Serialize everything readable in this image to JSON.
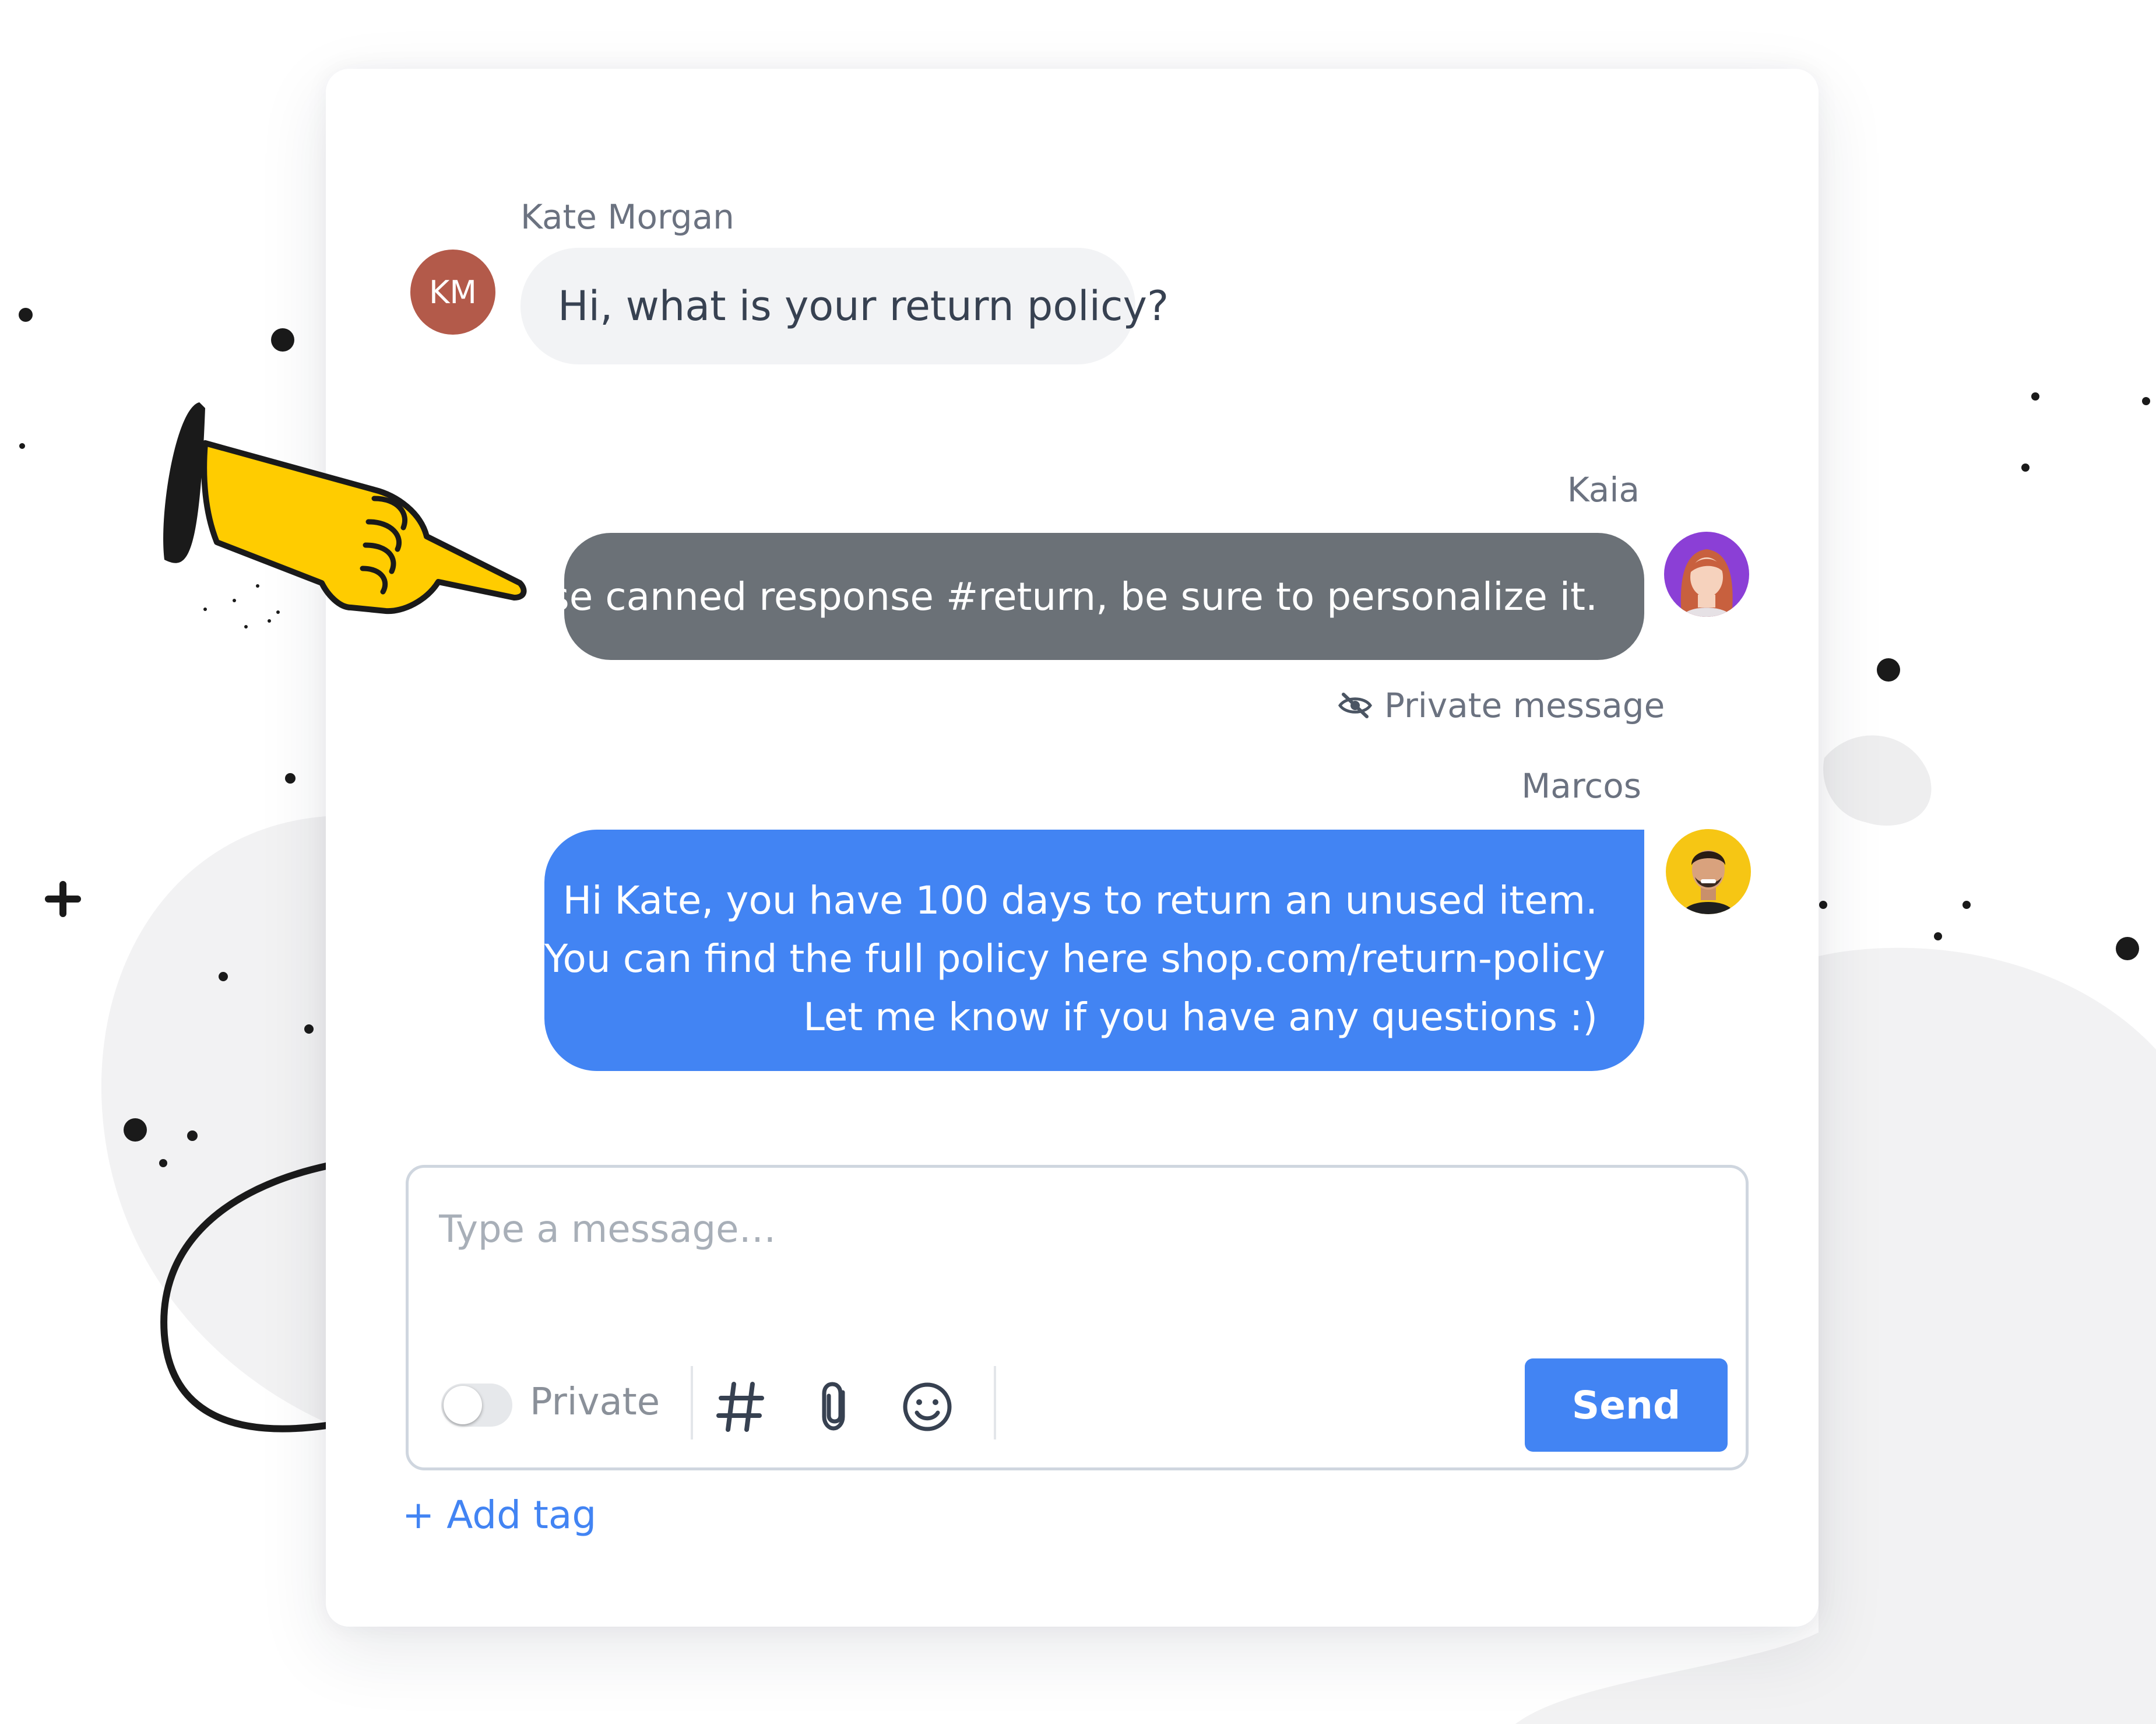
{
  "conversation": {
    "messages": [
      {
        "sender": "Kate Morgan",
        "initials": "KM",
        "text": "Hi, what is your return policy?",
        "direction": "incoming",
        "avatar_color": "#b35a4a"
      },
      {
        "sender": "Kaia",
        "text": "Use canned response #return, be sure to personalize it.",
        "direction": "outgoing-private",
        "bubble_color": "#6b7177",
        "note": "Private message"
      },
      {
        "sender": "Marcos",
        "lines": [
          "Hi Kate, you have 100 days to return an unused item.",
          "You can find the full policy here shop.com/return-policy",
          "Let me know if you have any questions :)"
        ],
        "direction": "outgoing",
        "bubble_color": "#4284f3"
      }
    ]
  },
  "composer": {
    "placeholder": "Type a message…",
    "private_toggle_label": "Private",
    "private_toggle_on": false,
    "tools": [
      "hashtag-icon",
      "paperclip-icon",
      "smiley-icon"
    ],
    "send_label": "Send"
  },
  "footer": {
    "add_tag_label": "+ Add tag"
  },
  "colors": {
    "accent": "#4284f3",
    "private_bubble": "#6b7177",
    "incoming_bubble": "#f2f3f5",
    "pointing_hand": "#ffcc00"
  }
}
